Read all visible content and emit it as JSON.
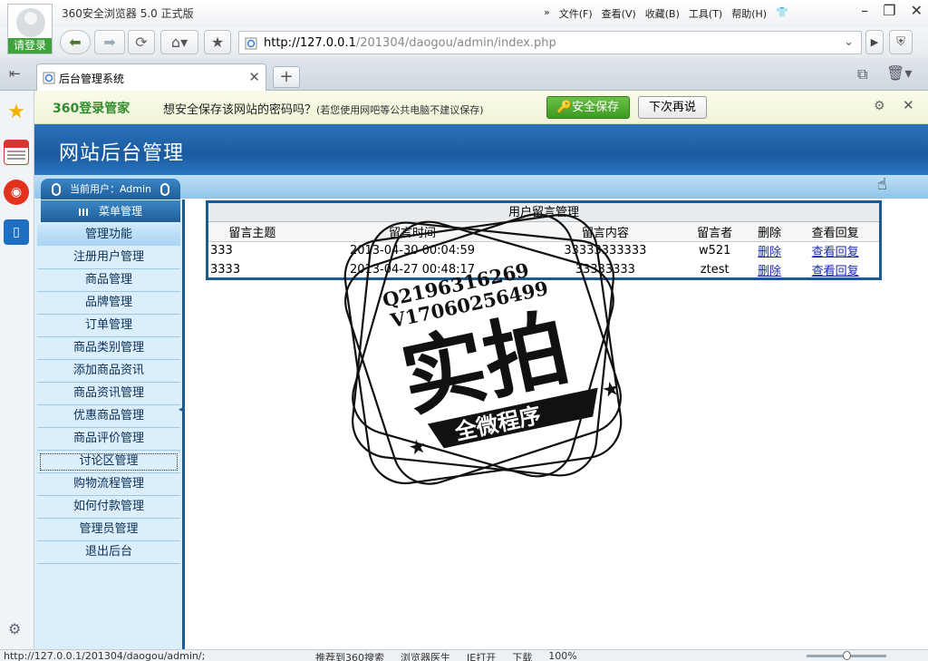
{
  "browser": {
    "login_label": "请登录",
    "title": "360安全浏览器 5.0 正式版",
    "menu": [
      "文件(F)",
      "查看(V)",
      "收藏(B)",
      "工具(T)",
      "帮助(H)"
    ],
    "address_prefix": "http://127.0.0.1",
    "address_rest": "/201304/daogou/admin/index.php",
    "tab_title": "后台管理系统"
  },
  "password_bar": {
    "brand": "360登录管家",
    "message": "想安全保存该网站的密码吗？",
    "note": "(若您使用网吧等公共电脑不建议保存)",
    "save_label": "安全保存",
    "later_label": "下次再说"
  },
  "site": {
    "title": "网站后台管理",
    "current_user": "当前用户：Admin",
    "menu_header": "菜单管理",
    "func_header": "管理功能",
    "nav": [
      "注册用户管理",
      "商品管理",
      "品牌管理",
      "订单管理",
      "商品类别管理",
      "添加商品资讯",
      "商品资讯管理",
      "优惠商品管理",
      "商品评价管理",
      "讨论区管理",
      "购物流程管理",
      "如何付款管理",
      "管理员管理",
      "退出后台"
    ]
  },
  "messages": {
    "caption": "用户留言管理",
    "headers": [
      "留言主题",
      "留言时间",
      "留言内容",
      "留言者",
      "删除",
      "查看回复"
    ],
    "rows": [
      {
        "subject": "333",
        "time": "2013-04-30 00:04:59",
        "content": "33333333333",
        "author": "w521",
        "delete": "删除",
        "reply": "查看回复"
      },
      {
        "subject": "3333",
        "time": "2013-04-27 00:48:17",
        "content": "33333333",
        "author": "ztest",
        "delete": "删除",
        "reply": "查看回复"
      }
    ]
  },
  "watermark": {
    "line1": "Q2196316269",
    "line2": "V17060256499",
    "big": "实拍",
    "ribbon": "全微程序"
  },
  "statusbar": {
    "url": "http://127.0.0.1/201304/daogou/admin/;",
    "items": [
      "推荐到360搜索",
      "浏览器医生",
      "IE打开",
      "下载",
      "100%"
    ]
  }
}
